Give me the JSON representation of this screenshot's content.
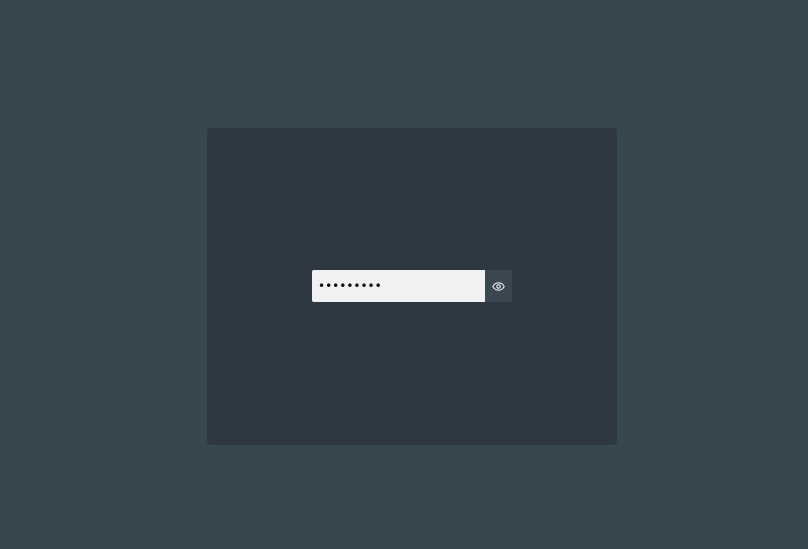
{
  "login": {
    "password_value": "123456789",
    "toggle_icon": "eye-icon"
  },
  "colors": {
    "background": "#37474f",
    "card": "#2e3841",
    "input_bg": "#f1f1f3",
    "toggle_bg": "#3a4750"
  }
}
